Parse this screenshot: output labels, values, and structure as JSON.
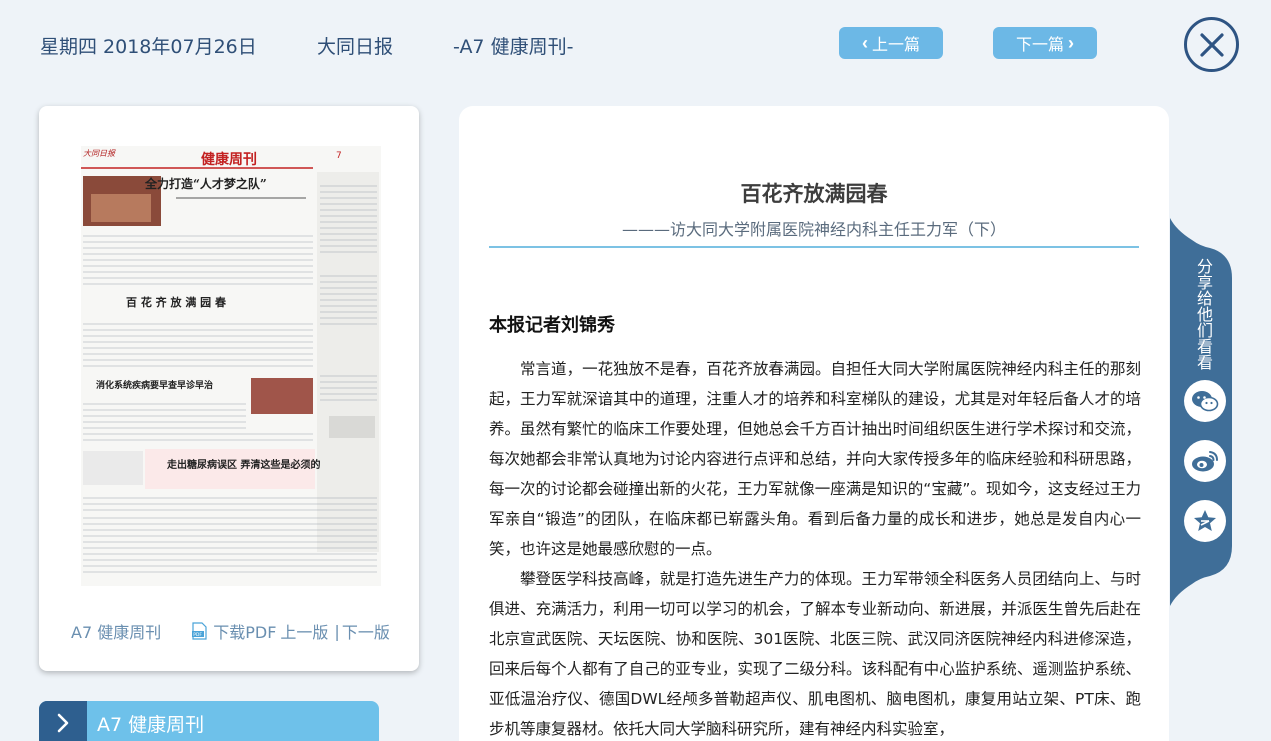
{
  "header": {
    "date": "星期四 2018年07月26日",
    "paper_name": "大同日报",
    "edition": "-A7 健康周刊-",
    "prev_label": "上一篇",
    "next_label": "下一篇"
  },
  "card": {
    "section": "A7 健康周刊",
    "download_pdf": "下载PDF",
    "prev_page": "上一版",
    "separator": "|",
    "next_page": "下一版"
  },
  "section_bar": {
    "label": "A7  健康周刊"
  },
  "article": {
    "title": "百花齐放满园春",
    "subtitle": "———访大同大学附属医院神经内科主任王力军（下）",
    "byline": "本报记者刘锦秀",
    "paragraphs": [
      "常言道，一花独放不是春，百花齐放春满园。自担任大同大学附属医院神经内科主任的那刻起，王力军就深谙其中的道理，注重人才的培养和科室梯队的建设，尤其是对年轻后备人才的培养。虽然有繁忙的临床工作要处理，但她总会千方百计抽出时间组织医生进行学术探讨和交流，每次她都会非常认真地为讨论内容进行点评和总结，并向大家传授多年的临床经验和科研思路，每一次的讨论都会碰撞出新的火花，王力军就像一座满是知识的“宝藏”。现如今，这支经过王力军亲自“锻造”的团队，在临床都已崭露头角。看到后备力量的成长和进步，她总是发自内心一笑，也许这是她最感欣慰的一点。",
      "攀登医学科技高峰，就是打造先进生产力的体现。王力军带领全科医务人员团结向上、与时俱进、充满活力，利用一切可以学习的机会，了解本专业新动向、新进展，并派医生曾先后赴在北京宣武医院、天坛医院、协和医院、301医院、北医三院、武汉同济医院神经内科进修深造，回来后每个人都有了自己的亚专业，实现了二级分科。该科配有中心监护系统、遥测监护系统、亚低温治疗仪、德国DWL经颅多普勒超声仪、肌电图机、脑电图机，康复用站立架、PT床、跑步机等康复器材。依托大同大学脑科研究所，建有神经内科实验室，"
    ]
  },
  "share": {
    "label": "分享给他们看看"
  },
  "thumbnail": {
    "masthead": "健康周刊",
    "page_no": "7",
    "logo": "大同日报",
    "headline_1": "全力打造“人才梦之队”",
    "headline_2": "百 花 齐 放 满 园 春",
    "headline_3": "消化系统疾病要早查早诊早治",
    "headline_4": "走出糖尿病误区  弄清这些是必须的"
  },
  "icons": {
    "close": "close-x-icon",
    "wechat": "wechat-icon",
    "weibo": "weibo-icon",
    "favorite": "favorite-star-icon",
    "pdf": "pdf-file-icon"
  },
  "colors": {
    "nav_button": "#6cb8e6",
    "close_ring": "#2e5483",
    "share_sidebar": "#3f6e98",
    "section_bar": "#6ec1ea",
    "rule": "#7cc2e4"
  }
}
